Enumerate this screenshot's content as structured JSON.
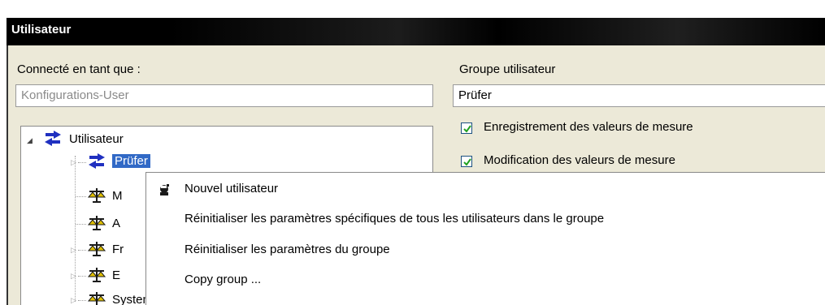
{
  "window": {
    "title": "Utilisateur"
  },
  "connected": {
    "label": "Connecté en tant que :",
    "value": "Konfigurations-User"
  },
  "group": {
    "label": "Groupe utilisateur",
    "value": "Prüfer"
  },
  "tree": {
    "root": {
      "label": "Utilisateur",
      "icon": "arrow-user-icon"
    },
    "items": [
      {
        "label": "Prüfer",
        "icon": "arrow-user-icon",
        "selected": true
      },
      {
        "label": "M",
        "icon": "scales-icon"
      },
      {
        "label": "A",
        "icon": "scales-icon"
      },
      {
        "label": "Fr",
        "icon": "scales-icon"
      },
      {
        "label": "E",
        "icon": "scales-icon"
      },
      {
        "label": "Systemadministrator",
        "icon": "scales-icon"
      }
    ]
  },
  "permissions": [
    {
      "label": "Enregistrement des valeurs de mesure",
      "checked": true
    },
    {
      "label": "Modification des valeurs de mesure",
      "checked": true
    }
  ],
  "context_menu": {
    "items": [
      {
        "label": "Nouvel utilisateur",
        "icon": "new-user-icon"
      },
      {
        "label": "Réinitialiser les paramètres spécifiques de tous les utilisateurs dans le groupe"
      },
      {
        "label": "Réinitialiser les paramètres du groupe"
      },
      {
        "label": "Copy group ..."
      }
    ]
  },
  "colors": {
    "titlebar": "#000000",
    "panel": "#ece9d8",
    "selection": "#3169c6",
    "checkbox_border": "#1c5180",
    "checkmark": "#21a121"
  }
}
